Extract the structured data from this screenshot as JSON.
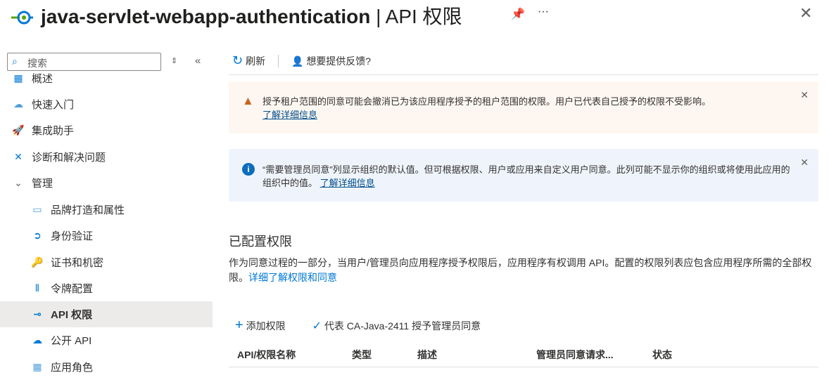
{
  "header": {
    "app_name": "java-servlet-webapp-authentication",
    "separator": " | ",
    "page": "API 权限"
  },
  "sidebar": {
    "search_placeholder": "搜索",
    "items": [
      {
        "label": "概述"
      },
      {
        "label": "快速入门"
      },
      {
        "label": "集成助手"
      },
      {
        "label": "诊断和解决问题"
      },
      {
        "label": "管理"
      },
      {
        "label": "品牌打造和属性"
      },
      {
        "label": "身份验证"
      },
      {
        "label": "证书和机密"
      },
      {
        "label": "令牌配置"
      },
      {
        "label": "API 权限"
      },
      {
        "label": "公开 API"
      },
      {
        "label": "应用角色"
      }
    ]
  },
  "toolbar": {
    "refresh": "刷新",
    "feedback": "想要提供反馈?"
  },
  "warning": {
    "text": "授予租户范围的同意可能会撤消已为该应用程序授予的租户范围的权限。用户已代表自己授予的权限不受影响。",
    "link": "了解详细信息"
  },
  "info": {
    "text": "“需要管理员同意”列显示组织的默认值。但可根据权限、用户或应用来自定义用户同意。此列可能不显示你的组织或将使用此应用的组织中的值。",
    "link": "了解详细信息"
  },
  "section": {
    "title": "已配置权限",
    "desc": "作为同意过程的一部分，当用户/管理员向应用程序授予权限后，应用程序有权调用 API。配置的权限列表应包含应用程序所需的全部权限。",
    "link": "详细了解权限和同意"
  },
  "actions": {
    "add": "添加权限",
    "grant": "代表 CA-Java-2411 授予管理员同意"
  },
  "table": {
    "columns": [
      "API/权限名称",
      "类型",
      "描述",
      "管理员同意请求...",
      "状态"
    ]
  }
}
